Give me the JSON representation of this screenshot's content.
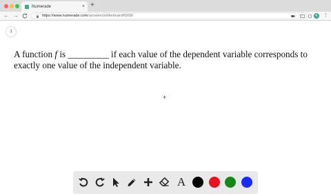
{
  "browser": {
    "tab_title": "Numerade",
    "tab_close": "×",
    "new_tab": "+",
    "nav": {
      "back": "←",
      "forward": "→",
      "reload": "C"
    },
    "url_host": "https://www.numerade.com",
    "url_path": "/answers/whiteboard/6568/",
    "star": "☆",
    "profile_initial": "K",
    "menu": "⋮",
    "accent_color": "#3aa98f"
  },
  "whiteboard": {
    "page_number": "1",
    "question": {
      "part1": "A function ",
      "variable": "f",
      "part2": " is _________ if each value of the dependent variable corresponds to exactly one value of the independent variable."
    },
    "cursor": "+"
  },
  "toolbar": {
    "tools": [
      "undo-icon",
      "redo-icon",
      "pointer-icon",
      "pencil-icon",
      "plus-icon",
      "eraser-icon",
      "text-icon"
    ],
    "text_tool_label": "A",
    "colors": [
      "#000000",
      "#e8141c",
      "#0e8a16",
      "#1a2bff"
    ]
  }
}
